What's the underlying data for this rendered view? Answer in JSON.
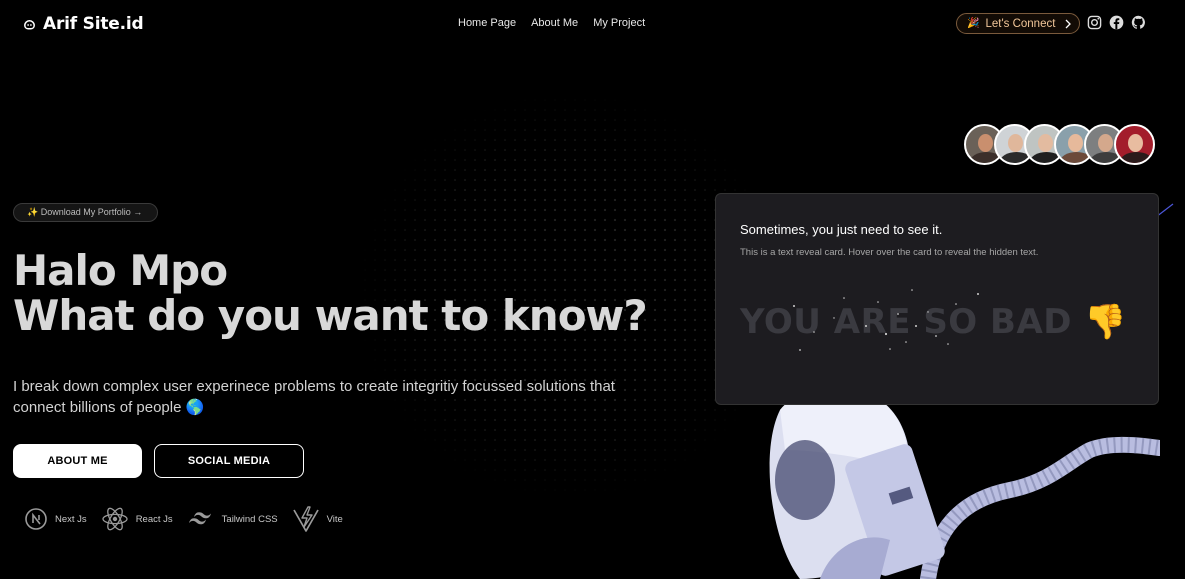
{
  "header": {
    "logo_text": "Arif Site.id",
    "nav": [
      "Home Page",
      "About Me",
      "My Project"
    ],
    "connect_label": "Let's Connect",
    "connect_emoji": "🎉",
    "social_icons": [
      "instagram-icon",
      "facebook-icon",
      "github-icon"
    ]
  },
  "avatars": {
    "count": 6
  },
  "hero": {
    "pill_label": "✨ Download My Portfolio →",
    "headline_line1": "Halo Mpo",
    "headline_line2": "What do you want to know?",
    "description": "I break down complex user experinece problems to create integritiy focussed solutions that connect billions of people 🌎",
    "about_button": "ABOUT ME",
    "social_button": "SOCIAL MEDIA",
    "tech": [
      {
        "label": "Next Js",
        "icon": "nextjs-icon"
      },
      {
        "label": "React Js",
        "icon": "react-icon"
      },
      {
        "label": "Tailwind CSS",
        "icon": "tailwind-icon"
      },
      {
        "label": "Vite",
        "icon": "vite-icon"
      }
    ]
  },
  "reveal_card": {
    "title": "Sometimes, you just need to see it.",
    "subtitle": "This is a text reveal card. Hover over the card to reveal the hidden text.",
    "hidden_text": "YOU ARE SO BAD 👎"
  },
  "colors": {
    "background": "#000000",
    "card_bg": "#1d1c20",
    "connect_accent": "#f2c79a",
    "headline": "#d8d8d8"
  }
}
